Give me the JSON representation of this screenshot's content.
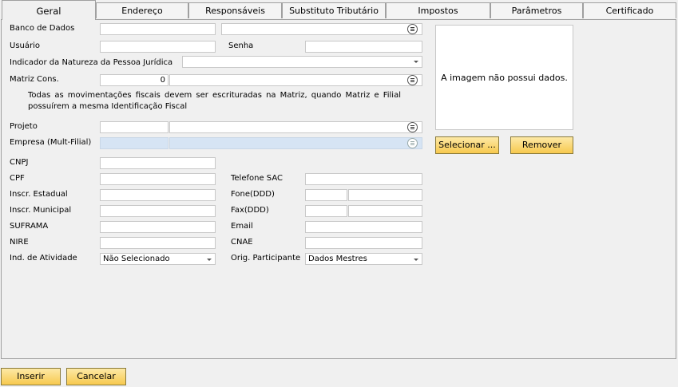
{
  "tabs": [
    "Geral",
    "Endereço",
    "Responsáveis",
    "Substituto Tributário",
    "Impostos",
    "Parâmetros",
    "Certificado"
  ],
  "fields": {
    "banco_de_dados": {
      "label": "Banco de Dados",
      "value": "",
      "value2": ""
    },
    "usuario": {
      "label": "Usuário",
      "value": ""
    },
    "senha": {
      "label": "Senha",
      "value": ""
    },
    "indicador_natureza": {
      "label": "Indicador da Natureza da Pessoa Jurídica",
      "value": ""
    },
    "matriz_cons": {
      "label": "Matriz Cons.",
      "value": "0",
      "value2": ""
    },
    "note": "Todas as movimentações fiscais devem ser escrituradas na Matriz, quando Matriz e Filial possuírem a mesma Identificação Fiscal",
    "projeto": {
      "label": "Projeto",
      "value": "",
      "value2": ""
    },
    "empresa": {
      "label": "Empresa (Mult-Filial)",
      "value": "",
      "value2": ""
    },
    "cnpj": {
      "label": "CNPJ",
      "value": ""
    },
    "cpf": {
      "label": "CPF",
      "value": ""
    },
    "telefone_sac": {
      "label": "Telefone SAC",
      "value": ""
    },
    "inscr_estadual": {
      "label": "Inscr. Estadual",
      "value": ""
    },
    "fone_ddd": {
      "label": "Fone(DDD)",
      "ddd": "",
      "value": ""
    },
    "inscr_municipal": {
      "label": "Inscr. Municipal",
      "value": ""
    },
    "fax_ddd": {
      "label": "Fax(DDD)",
      "ddd": "",
      "value": ""
    },
    "suframa": {
      "label": "SUFRAMA",
      "value": ""
    },
    "email": {
      "label": "Email",
      "value": ""
    },
    "nire": {
      "label": "NIRE",
      "value": ""
    },
    "cnae": {
      "label": "CNAE",
      "value": ""
    },
    "ind_atividade": {
      "label": "Ind. de Atividade",
      "value": "Não Selecionado"
    },
    "orig_participante": {
      "label": "Orig. Participante",
      "value": "Dados Mestres"
    }
  },
  "image": {
    "placeholder": "A imagem não possui dados.",
    "select_label": "Selecionar ...",
    "remove_label": "Remover"
  },
  "footer": {
    "insert_label": "Inserir",
    "cancel_label": "Cancelar"
  }
}
